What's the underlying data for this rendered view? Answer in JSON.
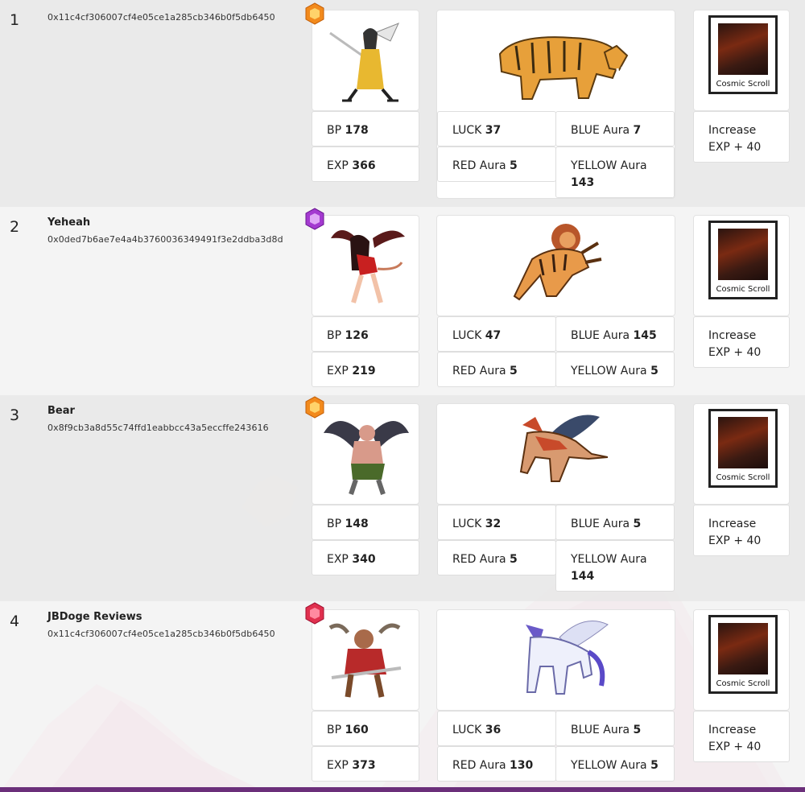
{
  "labels": {
    "bp": "BP",
    "exp": "EXP",
    "luck": "LUCK",
    "red_aura": "RED Aura",
    "blue_aura": "BLUE Aura",
    "yellow_aura": "YELLOW Aura",
    "item_name": "Cosmic Scroll",
    "item_effect": "Increase EXP + 40"
  },
  "rows": [
    {
      "rank": "1",
      "name": "",
      "address": "0x11c4cf306007cf4e05ce1a285cb346b0f5db6450",
      "gem_color": "#f28a1c",
      "hero_icon": "swordswoman-hero-icon",
      "pet_icon": "sabertooth-tiger-pet-icon",
      "bp": "178",
      "exp": "366",
      "luck": "37",
      "red_aura": "5",
      "blue_aura": "7",
      "yellow_aura": "143"
    },
    {
      "rank": "2",
      "name": "Yeheah",
      "address": "0x0ded7b6ae7e4a4b3760036349491f3e2ddba3d8d",
      "gem_color": "#a43ad0",
      "hero_icon": "succubus-hero-icon",
      "pet_icon": "tiger-lion-pet-icon",
      "bp": "126",
      "exp": "219",
      "luck": "47",
      "red_aura": "5",
      "blue_aura": "145",
      "yellow_aura": "5"
    },
    {
      "rank": "3",
      "name": "Bear",
      "address": "0x8f9cb3a8d55c74ffd1eabbcc43a5eccffe243616",
      "gem_color": "#f28a1c",
      "hero_icon": "winged-demon-hero-icon",
      "pet_icon": "griffin-pet-icon",
      "bp": "148",
      "exp": "340",
      "luck": "32",
      "red_aura": "5",
      "blue_aura": "5",
      "yellow_aura": "144"
    },
    {
      "rank": "4",
      "name": "JBDoge Reviews",
      "address": "0x11c4cf306007cf4e05ce1a285cb346b0f5db6450",
      "gem_color": "#e0304e",
      "hero_icon": "minotaur-warrior-hero-icon",
      "pet_icon": "pegasus-unicorn-pet-icon",
      "bp": "160",
      "exp": "373",
      "luck": "36",
      "red_aura": "130",
      "blue_aura": "5",
      "yellow_aura": "5"
    }
  ]
}
